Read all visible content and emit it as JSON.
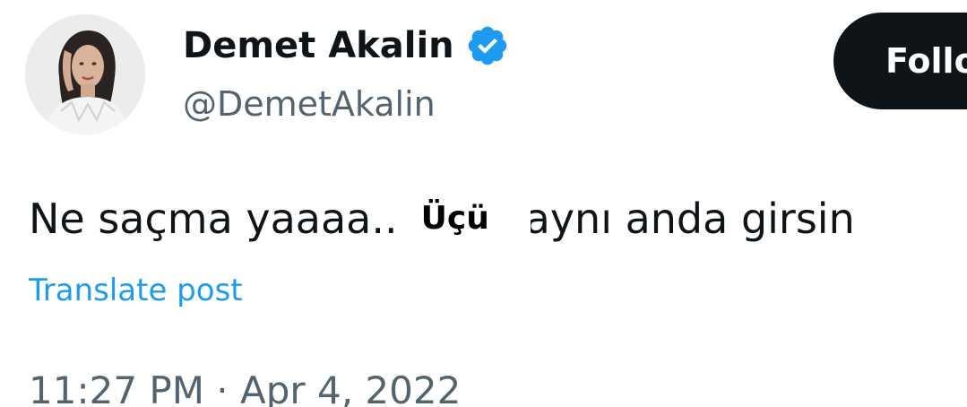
{
  "author": {
    "display_name": "Demet Akalin",
    "handle": "@DemetAkalin",
    "verified": true,
    "avatar_icon": "profile-photo"
  },
  "follow_button": {
    "label": "Follo"
  },
  "tweet": {
    "text_before": "Ne saçma yaaaa..",
    "censor_label": "Üçü",
    "text_after": "aynı anda girsin",
    "translate_label": "Translate post",
    "timestamp": "11:27 PM · Apr 4, 2022"
  },
  "colors": {
    "text_primary": "#0f1419",
    "text_secondary": "#536471",
    "link": "#1d9bf0",
    "verified_badge": "#1d9bf0",
    "follow_button_bg": "#0f1419",
    "follow_button_text": "#ffffff"
  }
}
